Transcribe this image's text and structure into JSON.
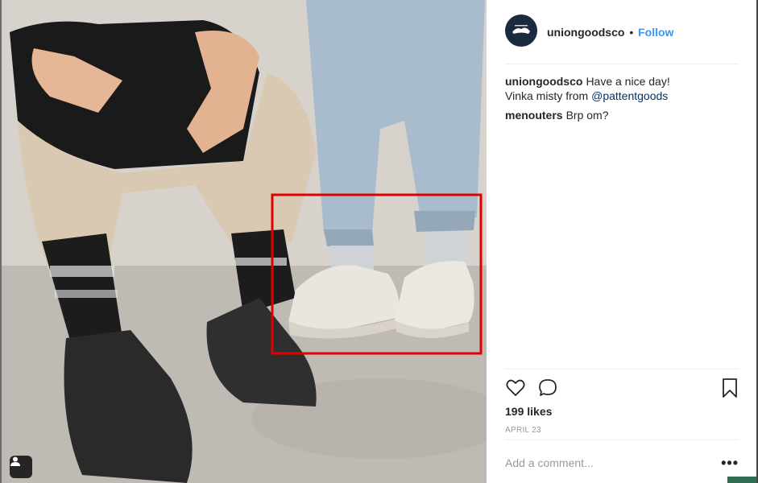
{
  "post": {
    "author": "uniongoodsco",
    "separator": "•",
    "follow_label": "Follow",
    "likes": "199 likes",
    "date": "APRIL 23"
  },
  "comments": [
    {
      "author": "uniongoodsco",
      "text_line1": "Have a nice day!",
      "text_line2": "Vinka misty from ",
      "mention": "@pattentgoods"
    },
    {
      "author": "menouters",
      "text": "Brp om?"
    }
  ],
  "add_comment": {
    "placeholder": "Add a comment...",
    "more_label": "•••"
  },
  "icons": {
    "like": "heart-icon",
    "comment": "comment-bubble-icon",
    "save": "bookmark-icon",
    "tag": "user-tag-icon"
  },
  "colors": {
    "follow": "#3897f0",
    "highlight_box": "#e00000",
    "avatar_bg": "#1b2a3f"
  }
}
